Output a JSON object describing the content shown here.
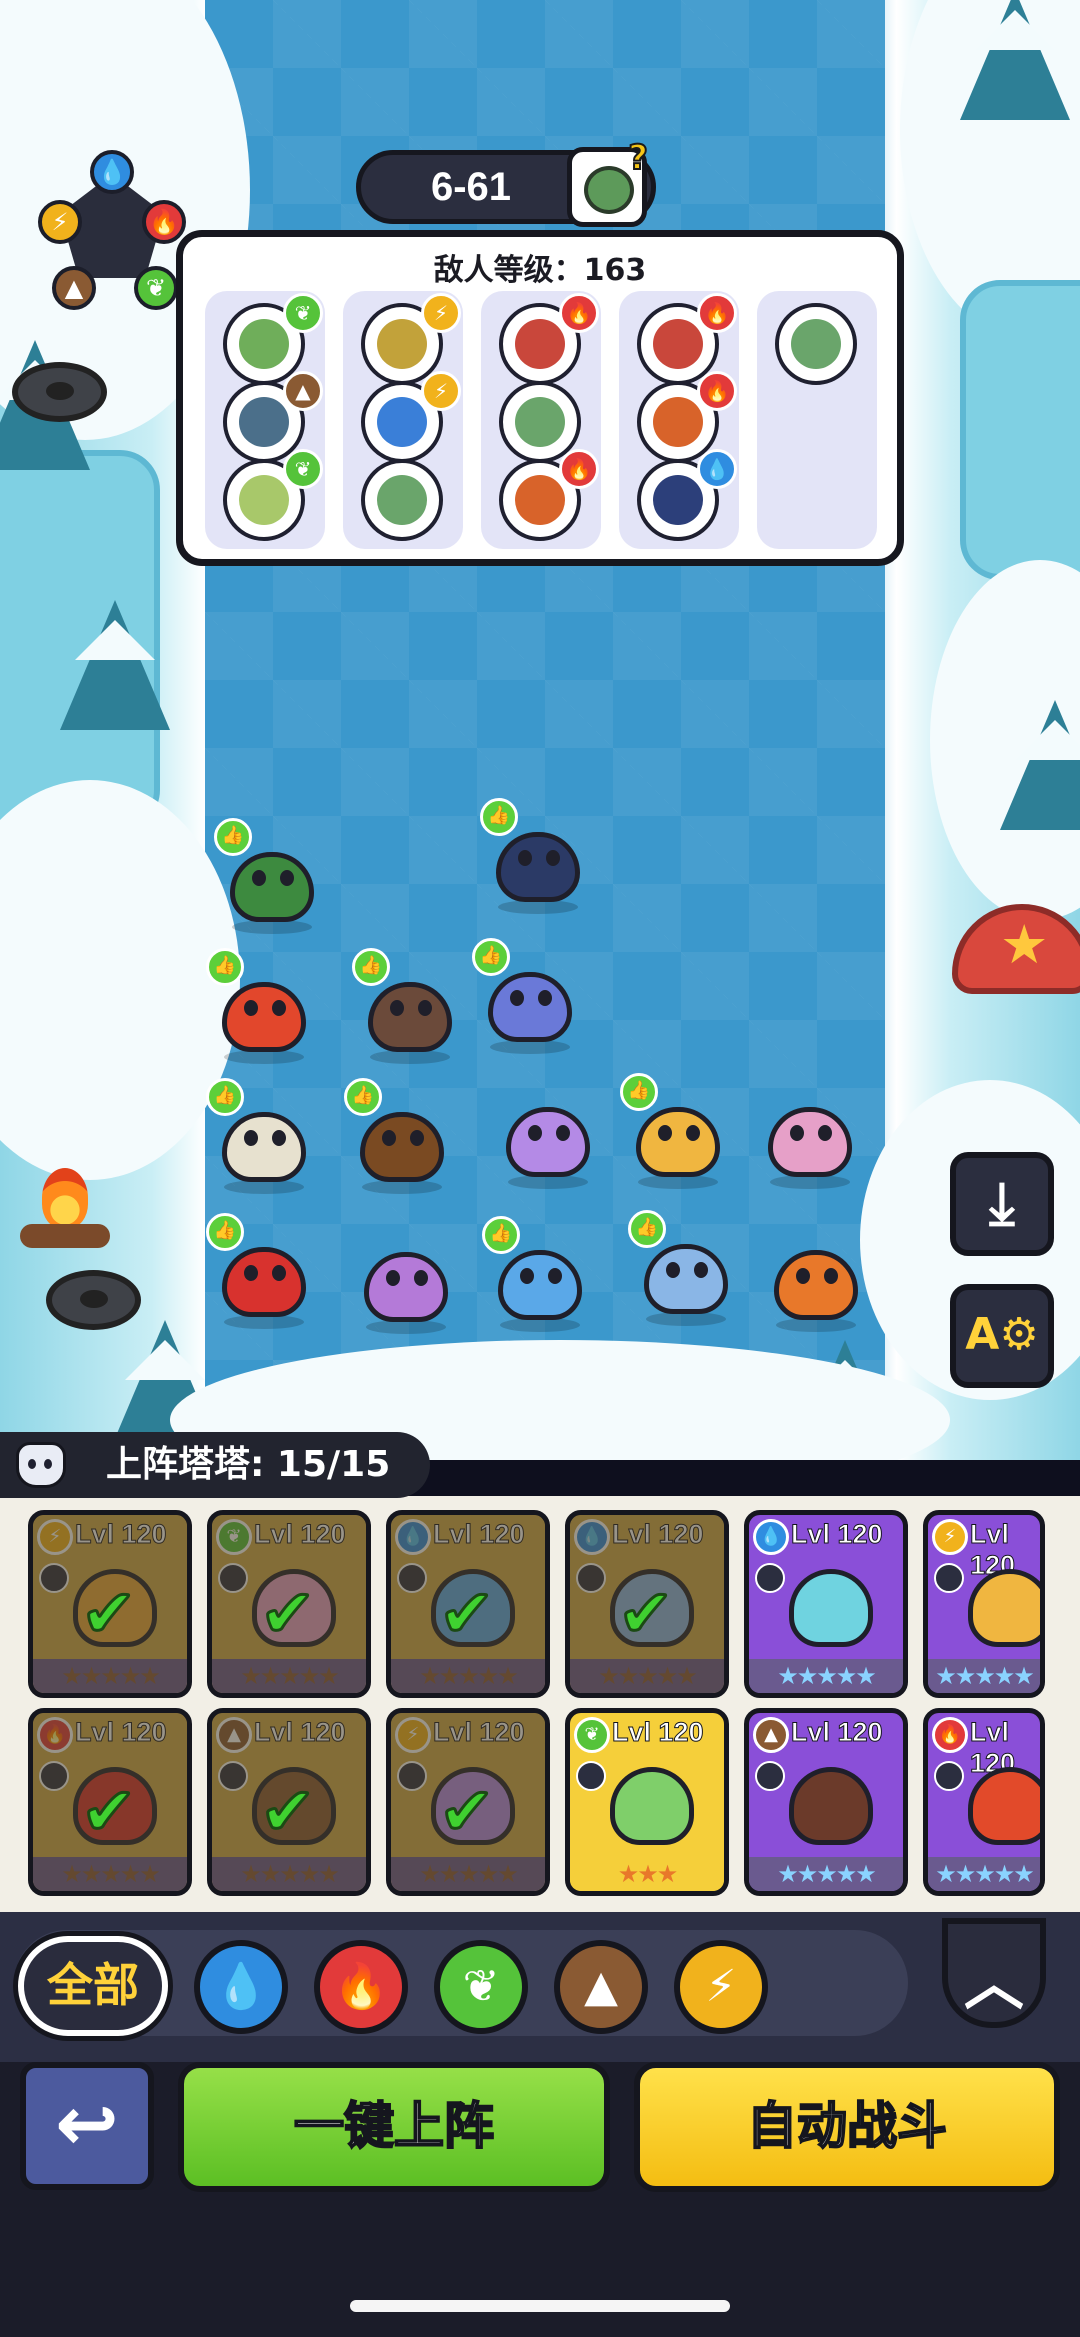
{
  "stage": {
    "label": "6-61"
  },
  "enemy_panel": {
    "level_text": "敌人等级：163",
    "columns": [
      {
        "enemies": [
          {
            "color": "#6fae5a",
            "element": "grass"
          },
          {
            "color": "#4b6f8a",
            "element": "earth"
          },
          {
            "color": "#a8c86a",
            "element": "grass"
          }
        ]
      },
      {
        "enemies": [
          {
            "color": "#c2a23a",
            "element": "lightning"
          },
          {
            "color": "#3a7fd8",
            "element": "lightning"
          },
          {
            "color": "#6aa56b",
            "element": "none"
          }
        ]
      },
      {
        "enemies": [
          {
            "color": "#c9473b",
            "element": "fire"
          },
          {
            "color": "#6aa56b",
            "element": "none"
          },
          {
            "color": "#d8632a",
            "element": "fire"
          }
        ]
      },
      {
        "enemies": [
          {
            "color": "#c9473b",
            "element": "fire"
          },
          {
            "color": "#d8632a",
            "element": "fire"
          },
          {
            "color": "#2c3f7a",
            "element": "water"
          }
        ]
      },
      {
        "enemies": [
          {
            "color": "#6aa56b",
            "element": "none"
          }
        ]
      }
    ]
  },
  "elements": {
    "water": {
      "color": "#2f8de0",
      "icon": "water-drop-icon",
      "glyph": "💧"
    },
    "fire": {
      "color": "#e23a3a",
      "icon": "flame-icon",
      "glyph": "🔥"
    },
    "grass": {
      "color": "#55c33a",
      "icon": "leaf-icon",
      "glyph": "❦"
    },
    "earth": {
      "color": "#8a5a33",
      "icon": "mountain-icon",
      "glyph": "▲"
    },
    "lightning": {
      "color": "#f1b21c",
      "icon": "lightning-icon",
      "glyph": "⚡"
    },
    "none": {
      "color": "#cccccc",
      "icon": "none",
      "glyph": ""
    }
  },
  "roster": {
    "header_label": "上阵塔塔: 15/15",
    "cards": [
      {
        "level": "Lvl 120",
        "element": "lightning",
        "color": "#e8a63b",
        "bg": "#cfa84a",
        "used": true,
        "stars": "★★★★★"
      },
      {
        "level": "Lvl 120",
        "element": "grass",
        "color": "#e6a0c8",
        "bg": "#cfa84a",
        "used": true,
        "stars": "★★★★★"
      },
      {
        "level": "Lvl 120",
        "element": "water",
        "color": "#5aa8e8",
        "bg": "#cfa84a",
        "used": true,
        "stars": "★★★★★"
      },
      {
        "level": "Lvl 120",
        "element": "water",
        "color": "#8ab6e6",
        "bg": "#cfa84a",
        "used": true,
        "stars": "★★★★★"
      },
      {
        "level": "Lvl 120",
        "element": "water",
        "color": "#6fd3e0",
        "bg": "#8a4fd8",
        "used": false,
        "stars": "★★★★★"
      },
      {
        "level": "Lvl 120",
        "element": "lightning",
        "color": "#f0b640",
        "bg": "#8a4fd8",
        "used": false,
        "stars": "★★★★★"
      },
      {
        "level": "Lvl 120",
        "element": "fire",
        "color": "#d8322e",
        "bg": "#cfa84a",
        "used": true,
        "stars": "★★★★★"
      },
      {
        "level": "Lvl 120",
        "element": "earth",
        "color": "#8a5a33",
        "bg": "#cfa84a",
        "used": true,
        "stars": "★★★★★"
      },
      {
        "level": "Lvl 120",
        "element": "lightning",
        "color": "#b48ae6",
        "bg": "#cfa84a",
        "used": true,
        "stars": "★★★★★"
      },
      {
        "level": "Lvl 120",
        "element": "grass",
        "color": "#7fcf6a",
        "bg": "#f5cf3a",
        "used": false,
        "stars": "★★★"
      },
      {
        "level": "Lvl 120",
        "element": "earth",
        "color": "#6b3a2a",
        "bg": "#8a4fd8",
        "used": false,
        "stars": "★★★★★"
      },
      {
        "level": "Lvl 120",
        "element": "fire",
        "color": "#e24a2a",
        "bg": "#8a4fd8",
        "used": false,
        "stars": "★★★★★"
      }
    ]
  },
  "filters": {
    "all_label": "全部",
    "items": [
      {
        "name": "water",
        "icon": "water-drop-icon",
        "glyph": "💧",
        "color": "#2f8de0"
      },
      {
        "name": "fire",
        "icon": "flame-icon",
        "glyph": "🔥",
        "color": "#e23a3a"
      },
      {
        "name": "grass",
        "icon": "leaf-icon",
        "glyph": "❦",
        "color": "#55c33a"
      },
      {
        "name": "earth",
        "icon": "mountain-icon",
        "glyph": "▲",
        "color": "#8a5a33"
      },
      {
        "name": "lightning",
        "icon": "lightning-icon",
        "glyph": "⚡",
        "color": "#f1b21c"
      }
    ],
    "collapse_icon": "chevron-up-icon",
    "collapse_glyph": "︿"
  },
  "actions": {
    "back_glyph": "↩",
    "deploy_label": "一键上阵",
    "auto_label": "自动战斗"
  },
  "side_buttons": {
    "save_glyph": "⤓",
    "auto_arrange_glyph": "A⚙"
  },
  "units": [
    {
      "color": "#3d8a3f",
      "thumb": true
    },
    {
      "color": "#2b3a66",
      "thumb": true
    },
    {
      "color": "#e2472c",
      "thumb": true
    },
    {
      "color": "#6b4a3a",
      "thumb": true
    },
    {
      "color": "#6a79d8",
      "thumb": true
    },
    {
      "color": "#e7e1cf",
      "thumb": true
    },
    {
      "color": "#7a4a22",
      "thumb": true
    },
    {
      "color": "#b48ae6",
      "thumb": false
    },
    {
      "color": "#f0b640",
      "thumb": true
    },
    {
      "color": "#e6a0c8",
      "thumb": false
    },
    {
      "color": "#d8322e",
      "thumb": true
    },
    {
      "color": "#b47ad8",
      "thumb": false
    },
    {
      "color": "#5aa8e8",
      "thumb": true
    },
    {
      "color": "#8ab6e6",
      "thumb": true
    },
    {
      "color": "#e8782a",
      "thumb": false
    }
  ]
}
